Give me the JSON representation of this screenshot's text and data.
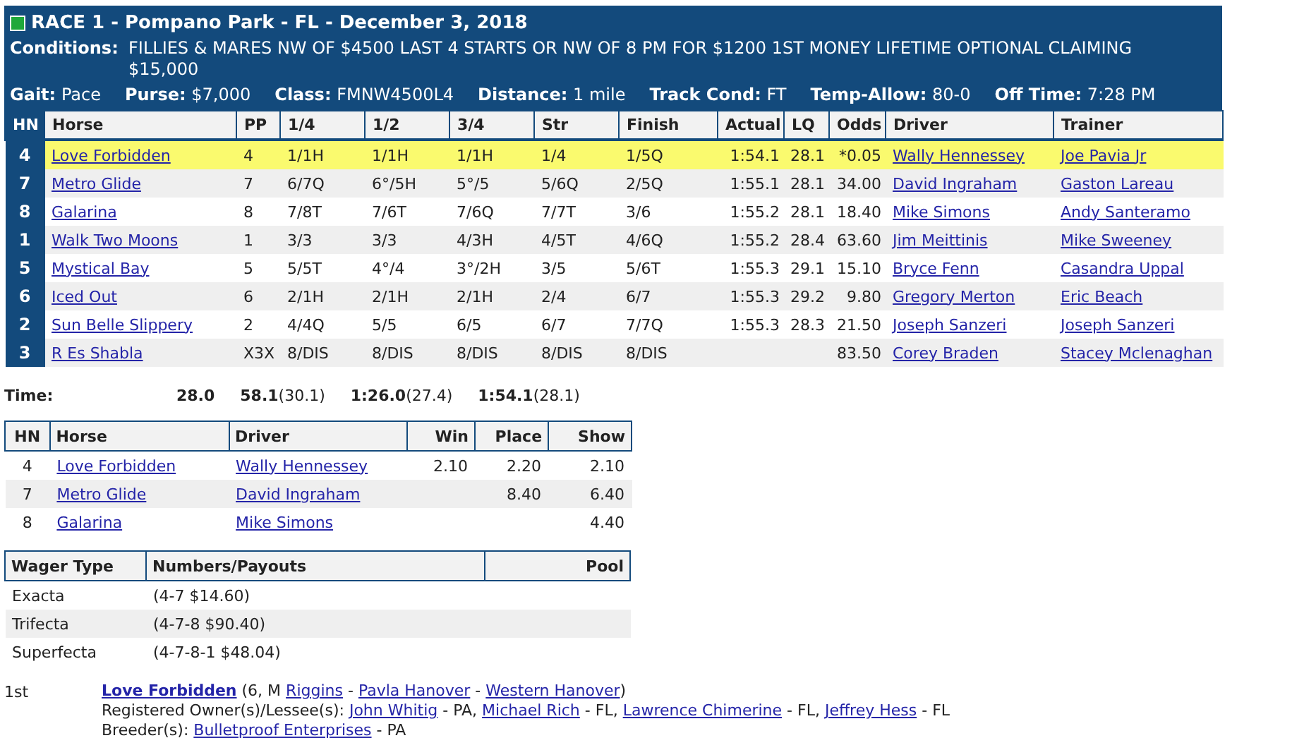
{
  "race": {
    "title": "RACE 1 - Pompano Park - FL - December 3, 2018",
    "conditions_label": "Conditions:",
    "conditions": "FILLIES & MARES NW OF $4500 LAST 4 STARTS OR NW OF 8 PM FOR $1200 1ST MONEY LIFETIME OPTIONAL CLAIMING $15,000",
    "info": [
      {
        "label": "Gait:",
        "value": "Pace"
      },
      {
        "label": "Purse:",
        "value": "$7,000"
      },
      {
        "label": "Class:",
        "value": "FMNW4500L4"
      },
      {
        "label": "Distance:",
        "value": "1 mile"
      },
      {
        "label": "Track Cond:",
        "value": "FT"
      },
      {
        "label": "Temp-Allow:",
        "value": "80-0"
      },
      {
        "label": "Off Time:",
        "value": "7:28 PM"
      }
    ]
  },
  "results": {
    "columns": [
      "HN",
      "Horse",
      "PP",
      "1/4",
      "1/2",
      "3/4",
      "Str",
      "Finish",
      "Actual",
      "LQ",
      "Odds",
      "Driver",
      "Trainer"
    ],
    "rows": [
      {
        "hn": "4",
        "horse": "Love Forbidden",
        "pp": "4",
        "q1": "1/1H",
        "q2": "1/1H",
        "q3": "1/1H",
        "str": "1/4",
        "finish": "1/5Q",
        "actual": "1:54.1",
        "lq": "28.1",
        "odds": "*0.05",
        "driver": "Wally Hennessey",
        "trainer": "Joe Pavia Jr",
        "highlighted": true
      },
      {
        "hn": "7",
        "horse": "Metro Glide",
        "pp": "7",
        "q1": "6/7Q",
        "q2": "6°/5H",
        "q3": "5°/5",
        "str": "5/6Q",
        "finish": "2/5Q",
        "actual": "1:55.1",
        "lq": "28.1",
        "odds": "34.00",
        "driver": "David Ingraham",
        "trainer": "Gaston Lareau",
        "highlighted": false
      },
      {
        "hn": "8",
        "horse": "Galarina",
        "pp": "8",
        "q1": "7/8T",
        "q2": "7/6T",
        "q3": "7/6Q",
        "str": "7/7T",
        "finish": "3/6",
        "actual": "1:55.2",
        "lq": "28.1",
        "odds": "18.40",
        "driver": "Mike Simons",
        "trainer": "Andy Santeramo",
        "highlighted": false
      },
      {
        "hn": "1",
        "horse": "Walk Two Moons",
        "pp": "1",
        "q1": "3/3",
        "q2": "3/3",
        "q3": "4/3H",
        "str": "4/5T",
        "finish": "4/6Q",
        "actual": "1:55.2",
        "lq": "28.4",
        "odds": "63.60",
        "driver": "Jim Meittinis",
        "trainer": "Mike Sweeney",
        "highlighted": false
      },
      {
        "hn": "5",
        "horse": "Mystical Bay",
        "pp": "5",
        "q1": "5/5T",
        "q2": "4°/4",
        "q3": "3°/2H",
        "str": "3/5",
        "finish": "5/6T",
        "actual": "1:55.3",
        "lq": "29.1",
        "odds": "15.10",
        "driver": "Bryce Fenn",
        "trainer": "Casandra Uppal",
        "highlighted": false
      },
      {
        "hn": "6",
        "horse": "Iced Out",
        "pp": "6",
        "q1": "2/1H",
        "q2": "2/1H",
        "q3": "2/1H",
        "str": "2/4",
        "finish": "6/7",
        "actual": "1:55.3",
        "lq": "29.2",
        "odds": "9.80",
        "driver": "Gregory Merton",
        "trainer": "Eric Beach",
        "highlighted": false
      },
      {
        "hn": "2",
        "horse": "Sun Belle Slippery",
        "pp": "2",
        "q1": "4/4Q",
        "q2": "5/5",
        "q3": "6/5",
        "str": "6/7",
        "finish": "7/7Q",
        "actual": "1:55.3",
        "lq": "28.3",
        "odds": "21.50",
        "driver": "Joseph Sanzeri",
        "trainer": "Joseph Sanzeri",
        "highlighted": false
      },
      {
        "hn": "3",
        "horse": "R Es Shabla",
        "pp": "X3X",
        "q1": "8/DIS",
        "q2": "8/DIS",
        "q3": "8/DIS",
        "str": "8/DIS",
        "finish": "8/DIS",
        "odds": "83.50",
        "driver": "Corey Braden",
        "trainer": "Stacey Mclenaghan",
        "highlighted": false
      }
    ]
  },
  "times": {
    "label": "Time:",
    "splits": [
      {
        "time": "28.0"
      },
      {
        "time": "58.1",
        "quarter": "(30.1)"
      },
      {
        "time": "1:26.0",
        "quarter": "(27.4)"
      },
      {
        "time": "1:54.1",
        "quarter": "(28.1)"
      }
    ]
  },
  "payouts": {
    "columns": [
      "HN",
      "Horse",
      "Driver",
      "Win",
      "Place",
      "Show"
    ],
    "rows": [
      {
        "hn": "4",
        "horse": "Love Forbidden",
        "driver": "Wally Hennessey",
        "win": "2.10",
        "place": "2.20",
        "show": "2.10"
      },
      {
        "hn": "7",
        "horse": "Metro Glide",
        "driver": "David Ingraham",
        "place": "8.40",
        "show": "6.40"
      },
      {
        "hn": "8",
        "horse": "Galarina",
        "driver": "Mike Simons",
        "show": "4.40"
      }
    ]
  },
  "wagers": {
    "columns": [
      "Wager Type",
      "Numbers/Payouts",
      "Pool"
    ],
    "rows": [
      {
        "type": "Exacta",
        "payout": "(4-7 $14.60)"
      },
      {
        "type": "Trifecta",
        "payout": "(4-7-8 $90.40)"
      },
      {
        "type": "Superfecta",
        "payout": "(4-7-8-1 $48.04)"
      }
    ]
  },
  "finisher": {
    "place": "1st",
    "lines": [
      [
        {
          "kind": "horse",
          "text": "Love Forbidden"
        },
        {
          "kind": "plain",
          "text": "(6, M"
        },
        {
          "kind": "link",
          "text": "Riggins"
        },
        {
          "kind": "plain",
          "text": "-"
        },
        {
          "kind": "link",
          "text": "Pavla Hanover"
        },
        {
          "kind": "plain",
          "text": "-"
        },
        {
          "kind": "link",
          "text": "Western Hanover"
        },
        {
          "kind": "plain",
          "text": ")",
          "attached": true
        }
      ],
      [
        {
          "kind": "plain",
          "text": "Registered Owner(s)/Lessee(s):"
        },
        {
          "kind": "link",
          "text": "John Whitig"
        },
        {
          "kind": "plain",
          "text": "- PA,"
        },
        {
          "kind": "link",
          "text": "Michael Rich"
        },
        {
          "kind": "plain",
          "text": "- FL,"
        },
        {
          "kind": "link",
          "text": "Lawrence Chimerine"
        },
        {
          "kind": "plain",
          "text": "- FL,"
        },
        {
          "kind": "link",
          "text": "Jeffrey Hess"
        },
        {
          "kind": "plain",
          "text": "- FL"
        }
      ],
      [
        {
          "kind": "plain",
          "text": "Breeder(s):"
        },
        {
          "kind": "link",
          "text": "Bulletproof Enterprises"
        },
        {
          "kind": "plain",
          "text": "- PA"
        }
      ]
    ]
  }
}
